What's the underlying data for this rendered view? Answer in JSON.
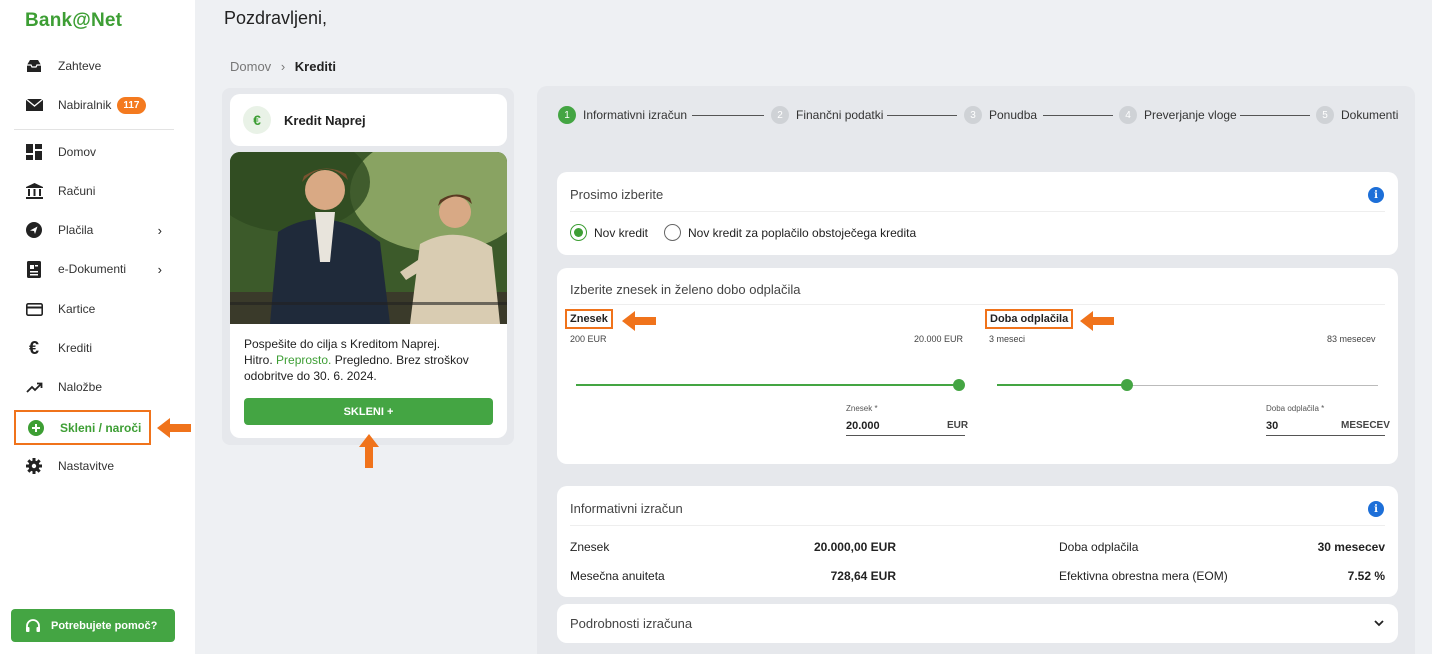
{
  "brand": {
    "name": "Bank@Net",
    "accent": "#3d9e34",
    "highlight": "#f0731b"
  },
  "sidebar": {
    "items": [
      {
        "label": "Zahteve",
        "icon": "inbox-icon"
      },
      {
        "label": "Nabiralnik",
        "icon": "envelope-icon",
        "badge": "117"
      },
      {
        "label": "Domov",
        "icon": "dashboard-icon"
      },
      {
        "label": "Računi",
        "icon": "bank-icon"
      },
      {
        "label": "Plačila",
        "icon": "send-icon"
      },
      {
        "label": "e-Dokumenti",
        "icon": "document-icon"
      },
      {
        "label": "Kartice",
        "icon": "card-icon"
      },
      {
        "label": "Krediti",
        "icon": "euro-icon"
      },
      {
        "label": "Naložbe",
        "icon": "trend-icon"
      },
      {
        "label": "Skleni / naroči",
        "icon": "plus-circle-icon"
      },
      {
        "label": "Nastavitve",
        "icon": "gear-icon"
      }
    ],
    "help_label": "Potrebujete pomoč?"
  },
  "header": {
    "greeting": "Pozdravljeni,"
  },
  "breadcrumb": {
    "home": "Domov",
    "separator": "›",
    "current": "Krediti"
  },
  "product": {
    "icon": "€",
    "title": "Kredit Naprej",
    "text_1": "Pospešite do cilja s Kreditom Naprej.",
    "text_2a": "Hitro. ",
    "text_2b": "Preprosto.",
    "text_2c": " Pregledno. Brez stroškov odobritve do 30. 6. 2024.",
    "button": "SKLENI  +"
  },
  "steps": [
    {
      "num": "1",
      "label": "Informativni izračun"
    },
    {
      "num": "2",
      "label": "Finančni podatki"
    },
    {
      "num": "3",
      "label": "Ponudba"
    },
    {
      "num": "4",
      "label": "Preverjanje vloge"
    },
    {
      "num": "5",
      "label": "Dokumenti"
    }
  ],
  "choice": {
    "title": "Prosimo izberite",
    "info": "i",
    "option_1": "Nov kredit",
    "option_2": "Nov kredit za poplačilo obstoječega kredita"
  },
  "amount": {
    "title": "Izberite znesek in želeno dobo odplačila",
    "znesek_label": "Znesek",
    "znesek_min": "200 EUR",
    "znesek_max": "20.000 EUR",
    "znesek_field_label": "Znesek *",
    "znesek_value": "20.000",
    "znesek_unit": "EUR",
    "znesek_fraction": 1.0,
    "doba_label": "Doba odplačila",
    "doba_min": "3 meseci",
    "doba_max": "83 mesecev",
    "doba_field_label": "Doba odplačila *",
    "doba_value": "30",
    "doba_unit": "MESECEV",
    "doba_fraction": 0.34
  },
  "calc": {
    "title": "Informativni izračun",
    "info": "i",
    "znesek_label": "Znesek",
    "znesek_value": "20.000,00 EUR",
    "anuiteta_label": "Mesečna anuiteta",
    "anuiteta_value": "728,64 EUR",
    "doba_label": "Doba odplačila",
    "doba_value": "30 mesecev",
    "eom_label": "Efektivna obrestna mera (EOM)",
    "eom_value": "7.52 %"
  },
  "details": {
    "title": "Podrobnosti izračuna",
    "chevron": "⌄"
  }
}
